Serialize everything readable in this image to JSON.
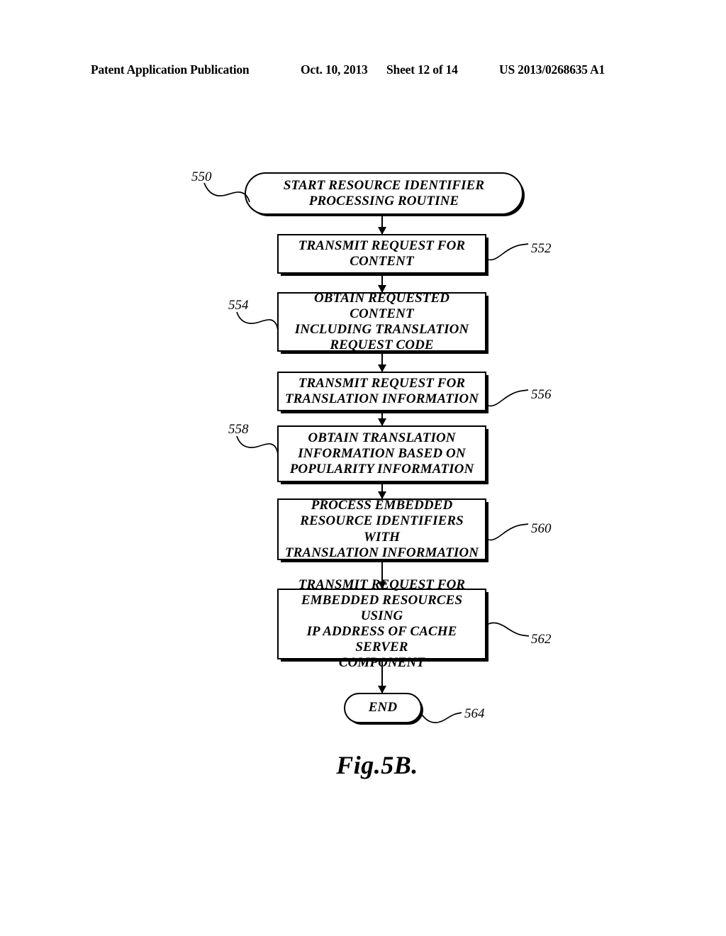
{
  "header": {
    "publication": "Patent Application Publication",
    "date": "Oct. 10, 2013",
    "sheet": "Sheet 12 of 14",
    "patent_number": "US 2013/0268635 A1"
  },
  "figure": {
    "caption": "Fig.5B.",
    "type": "flowchart",
    "nodes": [
      {
        "ref": "550",
        "shape": "terminator",
        "text": "START RESOURCE IDENTIFIER PROCESSING ROUTINE",
        "line1": "START RESOURCE IDENTIFIER",
        "line2": "PROCESSING ROUTINE"
      },
      {
        "ref": "552",
        "shape": "process",
        "text": "TRANSMIT REQUEST FOR CONTENT",
        "line1": "TRANSMIT REQUEST FOR",
        "line2": "CONTENT"
      },
      {
        "ref": "554",
        "shape": "process",
        "text": "OBTAIN REQUESTED CONTENT INCLUDING TRANSLATION REQUEST CODE",
        "line1": "OBTAIN REQUESTED CONTENT",
        "line2": "INCLUDING TRANSLATION",
        "line3": "REQUEST CODE"
      },
      {
        "ref": "556",
        "shape": "process",
        "text": "TRANSMIT REQUEST FOR TRANSLATION INFORMATION",
        "line1": "TRANSMIT REQUEST FOR",
        "line2": "TRANSLATION INFORMATION"
      },
      {
        "ref": "558",
        "shape": "process",
        "text": "OBTAIN TRANSLATION INFORMATION BASED ON POPULARITY INFORMATION",
        "line1": "OBTAIN TRANSLATION",
        "line2": "INFORMATION BASED ON",
        "line3": "POPULARITY INFORMATION"
      },
      {
        "ref": "560",
        "shape": "process",
        "text": "PROCESS EMBEDDED RESOURCE IDENTIFIERS WITH TRANSLATION INFORMATION",
        "line1": "PROCESS EMBEDDED",
        "line2": "RESOURCE IDENTIFIERS WITH",
        "line3": "TRANSLATION INFORMATION"
      },
      {
        "ref": "562",
        "shape": "process",
        "text": "TRANSMIT REQUEST FOR EMBEDDED RESOURCES USING IP ADDRESS OF CACHE SERVER COMPONENT",
        "line1": "TRANSMIT REQUEST FOR",
        "line2": "EMBEDDED RESOURCES USING",
        "line3": "IP ADDRESS OF CACHE SERVER",
        "line4": "COMPONENT"
      },
      {
        "ref": "564",
        "shape": "terminator",
        "text": "END",
        "line1": "END"
      }
    ]
  }
}
